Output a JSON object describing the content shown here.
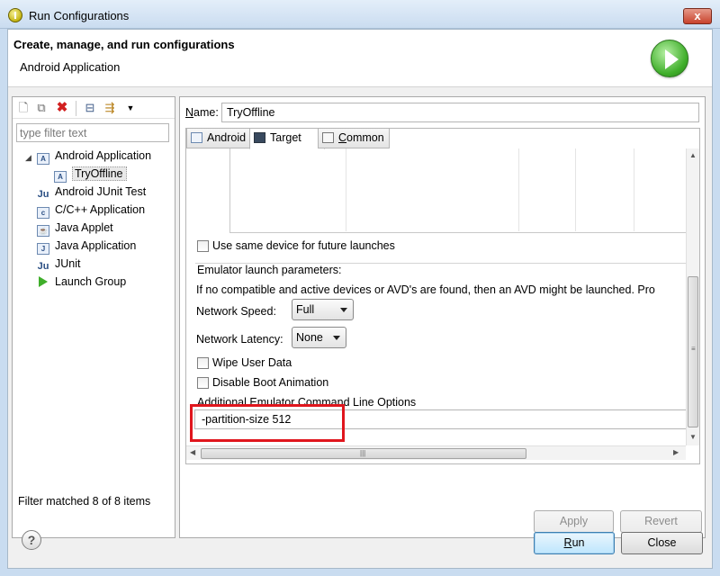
{
  "window": {
    "title": "Run Configurations",
    "close_glyph": "x"
  },
  "header": {
    "title": "Create, manage, and run configurations",
    "subtitle": "Android Application"
  },
  "left_toolbar": {
    "icons": [
      "new-launch-configuration-icon",
      "duplicate-icon",
      "delete-icon",
      "collapse-all-icon",
      "filter-icon",
      "view-menu-icon"
    ]
  },
  "filter": {
    "placeholder": "type filter text",
    "status": "Filter matched 8 of 8 items"
  },
  "tree": {
    "items": [
      {
        "label": "Android Application",
        "icon": "android-app-icon"
      },
      {
        "label": "TryOffline",
        "icon": "android-config-icon"
      },
      {
        "label": "Android JUnit Test",
        "icon": "junit-icon"
      },
      {
        "label": "C/C++ Application",
        "icon": "c-app-icon"
      },
      {
        "label": "Java Applet",
        "icon": "applet-icon"
      },
      {
        "label": "Java Application",
        "icon": "java-app-icon"
      },
      {
        "label": "JUnit",
        "icon": "junit-icon"
      },
      {
        "label": "Launch Group",
        "icon": "launch-group-icon"
      }
    ]
  },
  "name_field": {
    "label_accel": "N",
    "label_rest": "ame:",
    "value": "TryOffline"
  },
  "tabs": [
    {
      "label": "Android"
    },
    {
      "label": "Target"
    },
    {
      "label_accel": "C",
      "label_rest": "ommon"
    }
  ],
  "target": {
    "same_device_label": "Use same device for future launches",
    "emulator_group_label": "Emulator launch parameters:",
    "emulator_desc": "If no compatible and active devices or AVD's are found, then an AVD might be launched. Pro",
    "network_speed_label": "Network Speed:",
    "network_speed_value": "Full",
    "network_latency_label": "Network Latency:",
    "network_latency_value": "None",
    "wipe_label": "Wipe User Data",
    "disable_boot_label": "Disable Boot Animation",
    "cmd_label": "Additional Emulator Command Line Options",
    "cmd_value": "-partition-size 512"
  },
  "buttons": {
    "apply": "Apply",
    "revert": "Revert",
    "run_accel": "R",
    "run_rest": "un",
    "close": "Close"
  },
  "help": "?",
  "colors": {
    "highlight_box": "#e0161d",
    "run_icon_green": "#3fae2a"
  }
}
